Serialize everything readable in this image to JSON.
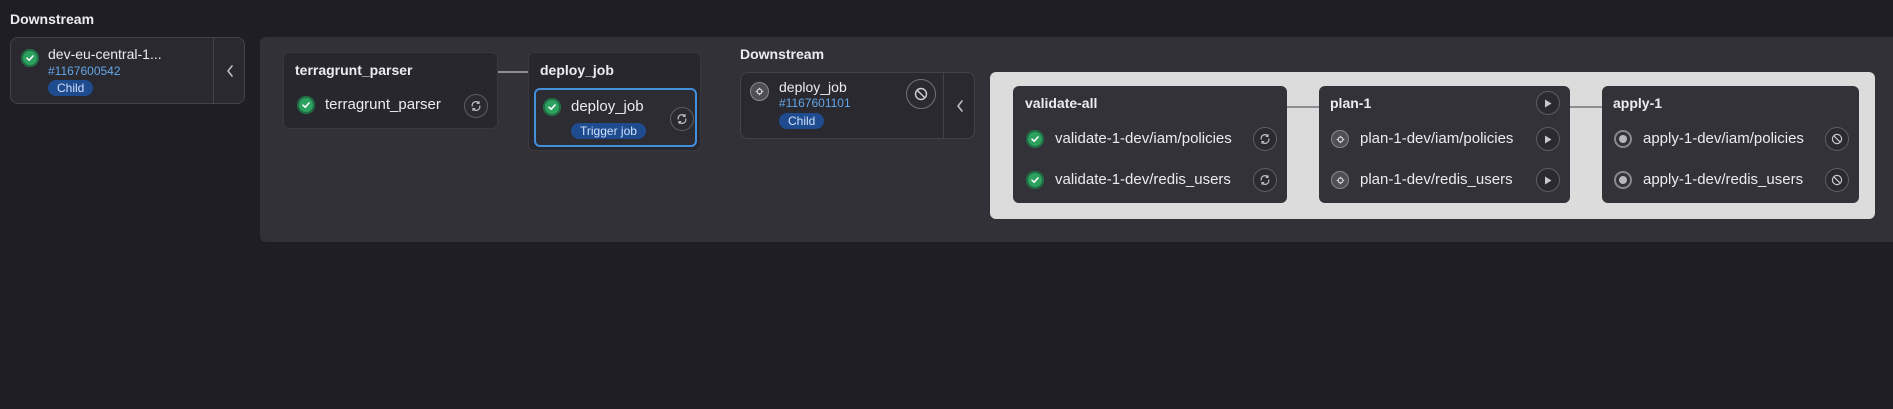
{
  "left_panel": {
    "title": "Downstream",
    "card": {
      "name": "dev-eu-central-1...",
      "id": "#1167600542",
      "badge": "Child",
      "status_icon": "check-circle-icon",
      "collapse_icon": "chevron-left-icon"
    }
  },
  "pipeline": {
    "stages": [
      {
        "title": "terragrunt_parser",
        "jobs": [
          {
            "name": "terragrunt_parser",
            "status": "success",
            "action": "retry-icon"
          }
        ]
      },
      {
        "title": "deploy_job",
        "jobs": [
          {
            "name": "deploy_job",
            "status": "success",
            "badge": "Trigger job",
            "action": "retry-icon"
          }
        ]
      }
    ],
    "downstream": {
      "title": "Downstream",
      "card": {
        "name": "deploy_job",
        "id": "#1167601101",
        "badge": "Child",
        "status": "skipped",
        "action": "cancel-icon",
        "collapse_icon": "chevron-left-icon"
      }
    },
    "child_stages": [
      {
        "title": "validate-all",
        "jobs": [
          {
            "name": "validate-1-dev/iam/policies",
            "status": "success",
            "action": "retry-icon"
          },
          {
            "name": "validate-1-dev/redis_users",
            "status": "success",
            "action": "retry-icon"
          }
        ]
      },
      {
        "title": "plan-1",
        "stage_action": "play-icon",
        "jobs": [
          {
            "name": "plan-1-dev/iam/policies",
            "status": "skipped",
            "action": "play-icon"
          },
          {
            "name": "plan-1-dev/redis_users",
            "status": "skipped",
            "action": "play-icon"
          }
        ]
      },
      {
        "title": "apply-1",
        "jobs": [
          {
            "name": "apply-1-dev/iam/policies",
            "status": "created",
            "action": "cancel-icon"
          },
          {
            "name": "apply-1-dev/redis_users",
            "status": "created",
            "action": "cancel-icon"
          }
        ]
      }
    ]
  },
  "colors": {
    "background": "#1f1e24",
    "panel": "#323137",
    "card": "#28272d",
    "child_panel": "#dcdcdc",
    "child_card": "#333238",
    "success": "#2da160",
    "link": "#63a6e9",
    "badge": "#1f4b8f",
    "focus_border": "#428fdc"
  }
}
